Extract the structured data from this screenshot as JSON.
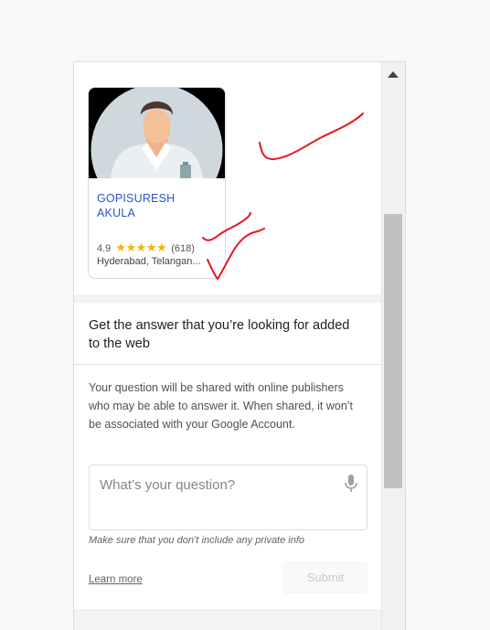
{
  "listing": {
    "name_line1": "GOPISURESH",
    "name_line2": "AKULA",
    "rating": "4.9",
    "stars": "★★★★★",
    "reviews": "(618)",
    "location": "Hyderabad, Telangan..."
  },
  "question": {
    "title": "Get the answer that you’re looking for added to the web",
    "description": "Your question will be shared with online publishers who may be able to answer it. When shared, it won’t be associated with your Google Account.",
    "placeholder": "What’s your question?",
    "privacy_note": "Make sure that you don’t include any private info",
    "learn_more": "Learn more",
    "submit_label": "Submit"
  },
  "colors": {
    "link_blue": "#2a56c6",
    "star_gold": "#f4b400",
    "annotation_red": "#e8141e"
  },
  "icons": [
    "doctor-avatar-icon",
    "star-icon",
    "microphone-icon",
    "scroll-up-arrow-icon"
  ]
}
